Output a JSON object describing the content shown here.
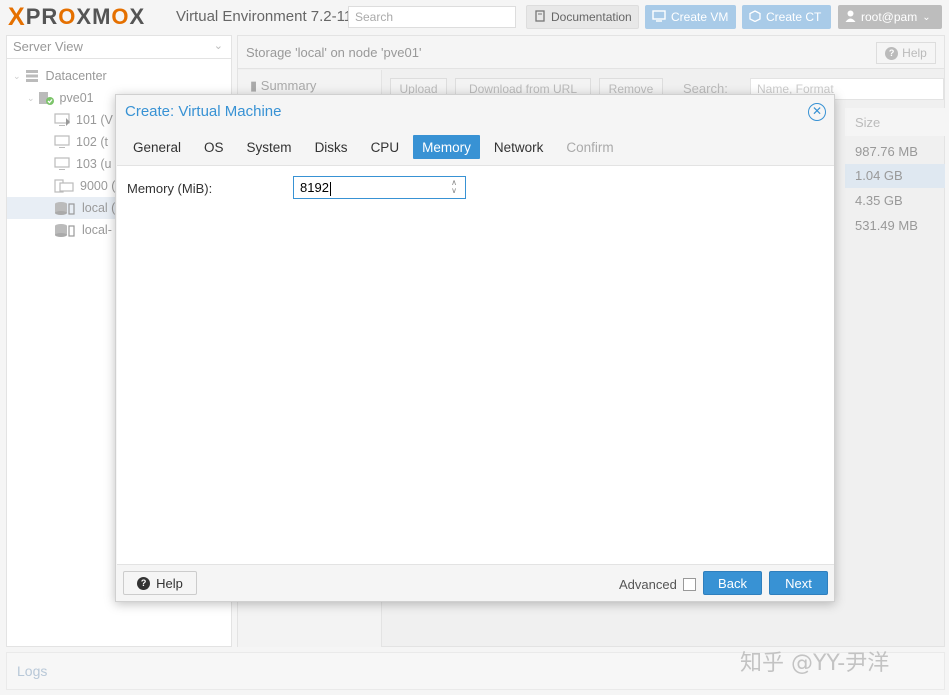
{
  "topbar": {
    "logo_x": "X",
    "logo_word": "PROXMOX",
    "title": "Virtual Environment 7.2-11",
    "search_placeholder": "Search",
    "documentation_label": "Documentation",
    "create_vm_label": "Create VM",
    "create_ct_label": "Create CT",
    "user_label": "root@pam"
  },
  "tree": {
    "view_label": "Server View",
    "items": [
      {
        "label": "Datacenter",
        "icon": "datacenter-icon"
      },
      {
        "label": "pve01",
        "icon": "node-icon"
      },
      {
        "label": "101 (V",
        "icon": "vm-icon"
      },
      {
        "label": "102 (t",
        "icon": "vm-icon"
      },
      {
        "label": "103 (u",
        "icon": "vm-icon"
      },
      {
        "label": "9000 (",
        "icon": "template-icon"
      },
      {
        "label": "local (",
        "icon": "storage-icon"
      },
      {
        "label": "local-",
        "icon": "storage-icon"
      }
    ]
  },
  "storage_panel": {
    "breadcrumb": "Storage 'local' on node 'pve01'",
    "help_label": "Help",
    "nav_summary": "Summary",
    "upload_label": "Upload",
    "download_label": "Download from URL",
    "remove_label": "Remove",
    "search_label": "Search:",
    "search_placeholder": "Name, Format",
    "size_header": "Size",
    "sizes": [
      "987.76 MB",
      "1.04 GB",
      "4.35 GB",
      "531.49 MB"
    ]
  },
  "logs_label": "Logs",
  "watermark": "知乎 @YY-尹洋",
  "dialog": {
    "title": "Create: Virtual Machine",
    "tabs": [
      "General",
      "OS",
      "System",
      "Disks",
      "CPU",
      "Memory",
      "Network",
      "Confirm"
    ],
    "active_tab": "Memory",
    "memory_label": "Memory (MiB):",
    "memory_value": "8192",
    "help_label": "Help",
    "advanced_label": "Advanced",
    "back_label": "Back",
    "next_label": "Next"
  },
  "colors": {
    "accent": "#3892d4",
    "logo_orange": "#e57000"
  }
}
